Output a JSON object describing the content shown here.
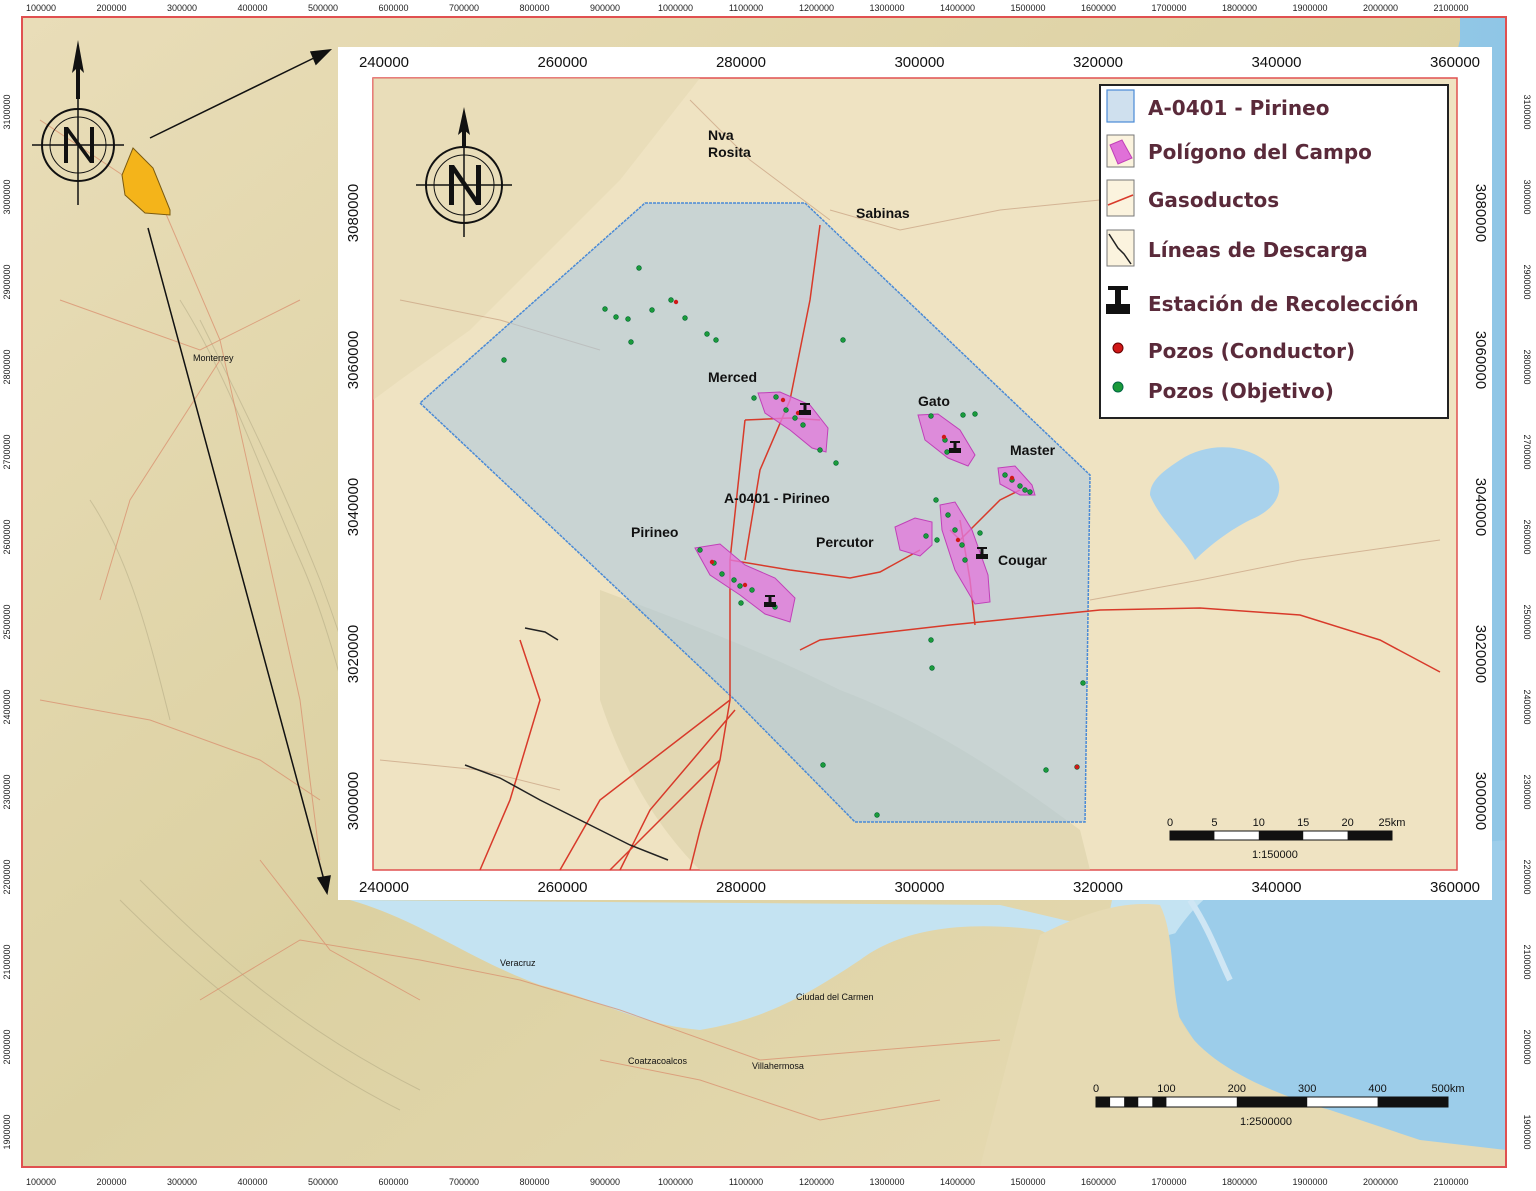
{
  "outer_map": {
    "x_ticks": [
      "100000",
      "200000",
      "300000",
      "400000",
      "500000",
      "600000",
      "700000",
      "800000",
      "900000",
      "1000000",
      "1100000",
      "1200000",
      "1300000",
      "1400000",
      "1500000",
      "1600000",
      "1700000",
      "1800000",
      "1900000",
      "2000000",
      "2100000"
    ],
    "y_ticks": [
      "3100000",
      "3000000",
      "2900000",
      "2800000",
      "2700000",
      "2600000",
      "2500000",
      "2400000",
      "2300000",
      "2200000",
      "2100000",
      "2000000",
      "1900000"
    ],
    "cities": [
      "Monterrey",
      "Veracruz",
      "Ciudad del Carmen",
      "Coatzacoalcos",
      "Villahermosa"
    ],
    "scale": {
      "ticks": [
        "0",
        "100",
        "200",
        "300",
        "400",
        "500km"
      ],
      "ratio": "1:2500000"
    },
    "colors": {
      "land": "#efe4c2",
      "sea": "#b9dcef",
      "frame": "#e05050",
      "study_area": "#f4b41a"
    }
  },
  "inset_map": {
    "x_ticks": [
      "240000",
      "260000",
      "280000",
      "300000",
      "320000",
      "340000",
      "360000"
    ],
    "y_ticks": [
      "3080000",
      "3060000",
      "3040000",
      "3020000",
      "3000000"
    ],
    "places": [
      "Nva\nRosita",
      "Sabinas"
    ],
    "area_label": "A-0401 - Pirineo",
    "fields": [
      "Merced",
      "Gato",
      "Master",
      "Pirineo",
      "Percutor",
      "Cougar"
    ],
    "legend": [
      {
        "label": "A-0401 - Pirineo",
        "icon": "blue-polygon-icon"
      },
      {
        "label": "Polígono del Campo",
        "icon": "pink-polygon-icon"
      },
      {
        "label": "Gasoductos",
        "icon": "red-line-icon"
      },
      {
        "label": "Líneas de Descarga",
        "icon": "black-line-icon"
      },
      {
        "label": "Estación de Recolección",
        "icon": "station-icon"
      },
      {
        "label": "Pozos (Conductor)",
        "icon": "red-dot-icon"
      },
      {
        "label": "Pozos (Objetivo)",
        "icon": "green-dot-icon"
      }
    ],
    "scale": {
      "ticks": [
        "0",
        "5",
        "10",
        "15",
        "20",
        "25km"
      ],
      "ratio": "1:150000"
    },
    "colors": {
      "block": "#4a8ad6",
      "field": "#e070d8",
      "pipeline": "#d83a2a",
      "well_conductor": "#d01818",
      "well_objective": "#1a9a3a"
    }
  }
}
